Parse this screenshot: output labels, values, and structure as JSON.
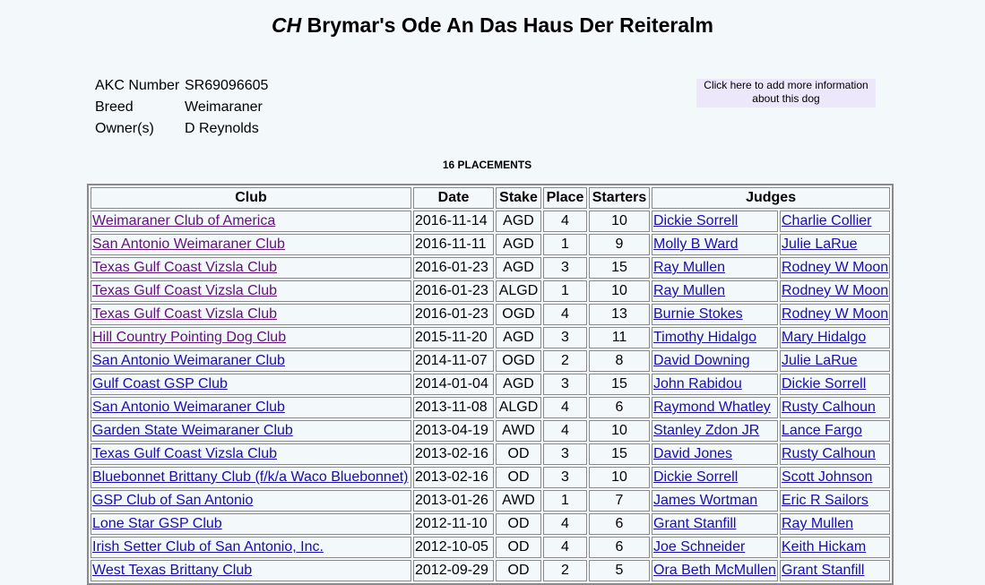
{
  "dog": {
    "title_prefix": "CH",
    "title_name": "Brymar's Ode An Das Haus Der Reiteralm",
    "details": [
      {
        "label": "AKC Number",
        "value": "SR69096605"
      },
      {
        "label": "Breed",
        "value": "Weimaraner"
      },
      {
        "label": "Owner(s)",
        "value": "D Reynolds"
      }
    ],
    "add_info": "Click here to add more information about this dog"
  },
  "placements_label": "16 PLACEMENTS",
  "table": {
    "headers": [
      "Club",
      "Date",
      "Stake",
      "Place",
      "Starters",
      "Judges"
    ],
    "rows": [
      {
        "club": "Weimaraner Club of America",
        "date": "2016-11-14",
        "stake": "AGD",
        "place": "4",
        "starters": "10",
        "judge1": "Dickie Sorrell",
        "judge2": "Charlie Collier",
        "visited": true
      },
      {
        "club": "San Antonio Weimaraner Club",
        "date": "2016-11-11",
        "stake": "AGD",
        "place": "1",
        "starters": "9",
        "judge1": "Molly B Ward",
        "judge2": "Julie LaRue",
        "visited": true
      },
      {
        "club": "Texas Gulf Coast Vizsla Club",
        "date": "2016-01-23",
        "stake": "AGD",
        "place": "3",
        "starters": "15",
        "judge1": "Ray Mullen",
        "judge2": "Rodney W Moon",
        "visited": true
      },
      {
        "club": "Texas Gulf Coast Vizsla Club",
        "date": "2016-01-23",
        "stake": "ALGD",
        "place": "1",
        "starters": "10",
        "judge1": "Ray Mullen",
        "judge2": "Rodney W Moon",
        "visited": true
      },
      {
        "club": "Texas Gulf Coast Vizsla Club",
        "date": "2016-01-23",
        "stake": "OGD",
        "place": "4",
        "starters": "13",
        "judge1": "Burnie Stokes",
        "judge2": "Rodney W Moon",
        "visited": true
      },
      {
        "club": "Hill Country Pointing Dog Club",
        "date": "2015-11-20",
        "stake": "AGD",
        "place": "3",
        "starters": "11",
        "judge1": "Timothy Hidalgo",
        "judge2": "Mary Hidalgo",
        "visited": true
      },
      {
        "club": "San Antonio Weimaraner Club",
        "date": "2014-11-07",
        "stake": "OGD",
        "place": "2",
        "starters": "8",
        "judge1": "David Downing",
        "judge2": "Julie LaRue",
        "visited": false
      },
      {
        "club": "Gulf Coast GSP Club",
        "date": "2014-01-04",
        "stake": "AGD",
        "place": "3",
        "starters": "15",
        "judge1": "John Rabidou",
        "judge2": "Dickie Sorrell",
        "visited": false
      },
      {
        "club": "San Antonio Weimaraner Club",
        "date": "2013-11-08",
        "stake": "ALGD",
        "place": "4",
        "starters": "6",
        "judge1": "Raymond Whatley",
        "judge2": "Rusty Calhoun",
        "visited": false
      },
      {
        "club": "Garden State Weimaraner Club",
        "date": "2013-04-19",
        "stake": "AWD",
        "place": "4",
        "starters": "10",
        "judge1": "Stanley Zdon JR",
        "judge2": "Lance Fargo",
        "visited": false
      },
      {
        "club": "Texas Gulf Coast Vizsla Club",
        "date": "2013-02-16",
        "stake": "OD",
        "place": "3",
        "starters": "15",
        "judge1": "David Jones",
        "judge2": "Rusty Calhoun",
        "visited": false
      },
      {
        "club": "Bluebonnet Brittany Club (f/k/a Waco Bluebonnet)",
        "date": "2013-02-16",
        "stake": "OD",
        "place": "3",
        "starters": "10",
        "judge1": "Dickie Sorrell",
        "judge2": "Scott Johnson",
        "visited": false
      },
      {
        "club": "GSP Club of San Antonio",
        "date": "2013-01-26",
        "stake": "AWD",
        "place": "1",
        "starters": "7",
        "judge1": "James Wortman",
        "judge2": "Eric R Sailors",
        "visited": false
      },
      {
        "club": "Lone Star GSP Club",
        "date": "2012-11-10",
        "stake": "OD",
        "place": "4",
        "starters": "6",
        "judge1": "Grant Stanfill",
        "judge2": "Ray Mullen",
        "visited": false
      },
      {
        "club": "Irish Setter Club of San Antonio, Inc.",
        "date": "2012-10-05",
        "stake": "OD",
        "place": "4",
        "starters": "6",
        "judge1": "Joe Schneider",
        "judge2": "Keith Hickam",
        "visited": false
      },
      {
        "club": "West Texas Brittany Club",
        "date": "2012-09-29",
        "stake": "OD",
        "place": "2",
        "starters": "5",
        "judge1": "Ora Beth McMullen",
        "judge2": "Grant Stanfill",
        "visited": false
      }
    ]
  }
}
